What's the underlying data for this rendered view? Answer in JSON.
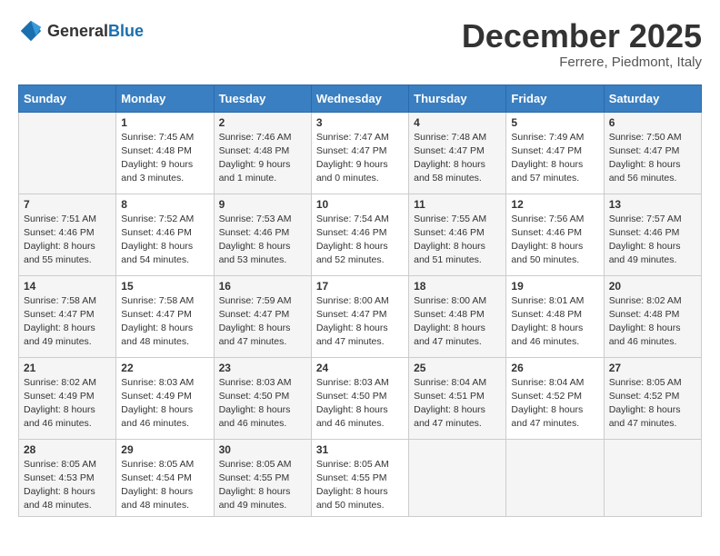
{
  "logo": {
    "general": "General",
    "blue": "Blue"
  },
  "title": "December 2025",
  "location": "Ferrere, Piedmont, Italy",
  "days_of_week": [
    "Sunday",
    "Monday",
    "Tuesday",
    "Wednesday",
    "Thursday",
    "Friday",
    "Saturday"
  ],
  "weeks": [
    [
      {
        "day": "",
        "sunrise": "",
        "sunset": "",
        "daylight": "",
        "empty": true
      },
      {
        "day": "1",
        "sunrise": "Sunrise: 7:45 AM",
        "sunset": "Sunset: 4:48 PM",
        "daylight": "Daylight: 9 hours and 3 minutes."
      },
      {
        "day": "2",
        "sunrise": "Sunrise: 7:46 AM",
        "sunset": "Sunset: 4:48 PM",
        "daylight": "Daylight: 9 hours and 1 minute."
      },
      {
        "day": "3",
        "sunrise": "Sunrise: 7:47 AM",
        "sunset": "Sunset: 4:47 PM",
        "daylight": "Daylight: 9 hours and 0 minutes."
      },
      {
        "day": "4",
        "sunrise": "Sunrise: 7:48 AM",
        "sunset": "Sunset: 4:47 PM",
        "daylight": "Daylight: 8 hours and 58 minutes."
      },
      {
        "day": "5",
        "sunrise": "Sunrise: 7:49 AM",
        "sunset": "Sunset: 4:47 PM",
        "daylight": "Daylight: 8 hours and 57 minutes."
      },
      {
        "day": "6",
        "sunrise": "Sunrise: 7:50 AM",
        "sunset": "Sunset: 4:47 PM",
        "daylight": "Daylight: 8 hours and 56 minutes."
      }
    ],
    [
      {
        "day": "7",
        "sunrise": "Sunrise: 7:51 AM",
        "sunset": "Sunset: 4:46 PM",
        "daylight": "Daylight: 8 hours and 55 minutes."
      },
      {
        "day": "8",
        "sunrise": "Sunrise: 7:52 AM",
        "sunset": "Sunset: 4:46 PM",
        "daylight": "Daylight: 8 hours and 54 minutes."
      },
      {
        "day": "9",
        "sunrise": "Sunrise: 7:53 AM",
        "sunset": "Sunset: 4:46 PM",
        "daylight": "Daylight: 8 hours and 53 minutes."
      },
      {
        "day": "10",
        "sunrise": "Sunrise: 7:54 AM",
        "sunset": "Sunset: 4:46 PM",
        "daylight": "Daylight: 8 hours and 52 minutes."
      },
      {
        "day": "11",
        "sunrise": "Sunrise: 7:55 AM",
        "sunset": "Sunset: 4:46 PM",
        "daylight": "Daylight: 8 hours and 51 minutes."
      },
      {
        "day": "12",
        "sunrise": "Sunrise: 7:56 AM",
        "sunset": "Sunset: 4:46 PM",
        "daylight": "Daylight: 8 hours and 50 minutes."
      },
      {
        "day": "13",
        "sunrise": "Sunrise: 7:57 AM",
        "sunset": "Sunset: 4:46 PM",
        "daylight": "Daylight: 8 hours and 49 minutes."
      }
    ],
    [
      {
        "day": "14",
        "sunrise": "Sunrise: 7:58 AM",
        "sunset": "Sunset: 4:47 PM",
        "daylight": "Daylight: 8 hours and 49 minutes."
      },
      {
        "day": "15",
        "sunrise": "Sunrise: 7:58 AM",
        "sunset": "Sunset: 4:47 PM",
        "daylight": "Daylight: 8 hours and 48 minutes."
      },
      {
        "day": "16",
        "sunrise": "Sunrise: 7:59 AM",
        "sunset": "Sunset: 4:47 PM",
        "daylight": "Daylight: 8 hours and 47 minutes."
      },
      {
        "day": "17",
        "sunrise": "Sunrise: 8:00 AM",
        "sunset": "Sunset: 4:47 PM",
        "daylight": "Daylight: 8 hours and 47 minutes."
      },
      {
        "day": "18",
        "sunrise": "Sunrise: 8:00 AM",
        "sunset": "Sunset: 4:48 PM",
        "daylight": "Daylight: 8 hours and 47 minutes."
      },
      {
        "day": "19",
        "sunrise": "Sunrise: 8:01 AM",
        "sunset": "Sunset: 4:48 PM",
        "daylight": "Daylight: 8 hours and 46 minutes."
      },
      {
        "day": "20",
        "sunrise": "Sunrise: 8:02 AM",
        "sunset": "Sunset: 4:48 PM",
        "daylight": "Daylight: 8 hours and 46 minutes."
      }
    ],
    [
      {
        "day": "21",
        "sunrise": "Sunrise: 8:02 AM",
        "sunset": "Sunset: 4:49 PM",
        "daylight": "Daylight: 8 hours and 46 minutes."
      },
      {
        "day": "22",
        "sunrise": "Sunrise: 8:03 AM",
        "sunset": "Sunset: 4:49 PM",
        "daylight": "Daylight: 8 hours and 46 minutes."
      },
      {
        "day": "23",
        "sunrise": "Sunrise: 8:03 AM",
        "sunset": "Sunset: 4:50 PM",
        "daylight": "Daylight: 8 hours and 46 minutes."
      },
      {
        "day": "24",
        "sunrise": "Sunrise: 8:03 AM",
        "sunset": "Sunset: 4:50 PM",
        "daylight": "Daylight: 8 hours and 46 minutes."
      },
      {
        "day": "25",
        "sunrise": "Sunrise: 8:04 AM",
        "sunset": "Sunset: 4:51 PM",
        "daylight": "Daylight: 8 hours and 47 minutes."
      },
      {
        "day": "26",
        "sunrise": "Sunrise: 8:04 AM",
        "sunset": "Sunset: 4:52 PM",
        "daylight": "Daylight: 8 hours and 47 minutes."
      },
      {
        "day": "27",
        "sunrise": "Sunrise: 8:05 AM",
        "sunset": "Sunset: 4:52 PM",
        "daylight": "Daylight: 8 hours and 47 minutes."
      }
    ],
    [
      {
        "day": "28",
        "sunrise": "Sunrise: 8:05 AM",
        "sunset": "Sunset: 4:53 PM",
        "daylight": "Daylight: 8 hours and 48 minutes."
      },
      {
        "day": "29",
        "sunrise": "Sunrise: 8:05 AM",
        "sunset": "Sunset: 4:54 PM",
        "daylight": "Daylight: 8 hours and 48 minutes."
      },
      {
        "day": "30",
        "sunrise": "Sunrise: 8:05 AM",
        "sunset": "Sunset: 4:55 PM",
        "daylight": "Daylight: 8 hours and 49 minutes."
      },
      {
        "day": "31",
        "sunrise": "Sunrise: 8:05 AM",
        "sunset": "Sunset: 4:55 PM",
        "daylight": "Daylight: 8 hours and 50 minutes."
      },
      {
        "day": "",
        "sunrise": "",
        "sunset": "",
        "daylight": "",
        "empty": true
      },
      {
        "day": "",
        "sunrise": "",
        "sunset": "",
        "daylight": "",
        "empty": true
      },
      {
        "day": "",
        "sunrise": "",
        "sunset": "",
        "daylight": "",
        "empty": true
      }
    ]
  ]
}
